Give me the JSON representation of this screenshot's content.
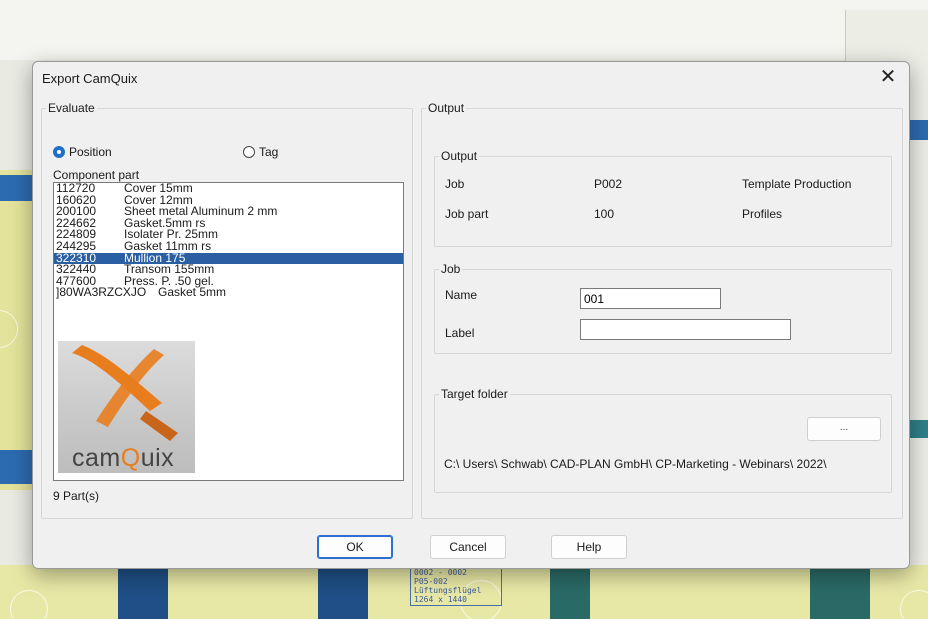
{
  "dialog": {
    "title": "Export CamQuix",
    "close_glyph": "✕"
  },
  "evaluate": {
    "legend": "Evaluate",
    "radio_position": "Position",
    "radio_tag": "Tag",
    "selected_radio": "Position",
    "component_label": "Component part",
    "rows": [
      {
        "code": "112720",
        "desc": "Cover 15mm"
      },
      {
        "code": "160620",
        "desc": "Cover 12mm"
      },
      {
        "code": "200100",
        "desc": "Sheet metal Aluminum 2 mm"
      },
      {
        "code": "224662",
        "desc": "Gasket.5mm rs"
      },
      {
        "code": "224809",
        "desc": "Isolater Pr. 25mm"
      },
      {
        "code": "244295",
        "desc": "Gasket 11mm rs"
      },
      {
        "code": "322310",
        "desc": "Mullion 175"
      },
      {
        "code": "322440",
        "desc": "Transom 155mm"
      },
      {
        "code": "477600",
        "desc": "Press. P. .50 gel."
      },
      {
        "code": "]80WA3RZCXJO",
        "desc": "Gasket 5mm"
      }
    ],
    "selected_row": "322310",
    "logo_text_a": "cam",
    "logo_text_q": "Q",
    "logo_text_b": "uix",
    "count": "9 Part(s)"
  },
  "output": {
    "legend": "Output",
    "sub_output": {
      "legend": "Output",
      "job_label": "Job",
      "job_value": "P002",
      "job_desc": "Template Production",
      "jobpart_label": "Job part",
      "jobpart_value": "100",
      "jobpart_desc": "Profiles"
    },
    "sub_job": {
      "legend": "Job",
      "name_label": "Name",
      "name_value": "001",
      "label_label": "Label",
      "label_value": ""
    },
    "sub_target": {
      "legend": "Target folder",
      "browse_label": "...",
      "path": "C:\\ Users\\ Schwab\\ CAD-PLAN GmbH\\ CP-Marketing - Webinars\\ 2022\\"
    }
  },
  "buttons": {
    "ok": "OK",
    "cancel": "Cancel",
    "help": "Help"
  },
  "background": {
    "cad_text_1": "0002 - 0002",
    "cad_text_2": "P05-002 Lüftungsflügel",
    "cad_text_3": "1264 x 1440"
  },
  "colors": {
    "selection": "#2a5fa3",
    "radio_accent": "#1f6fc9",
    "logo_accent": "#e87d1e"
  }
}
